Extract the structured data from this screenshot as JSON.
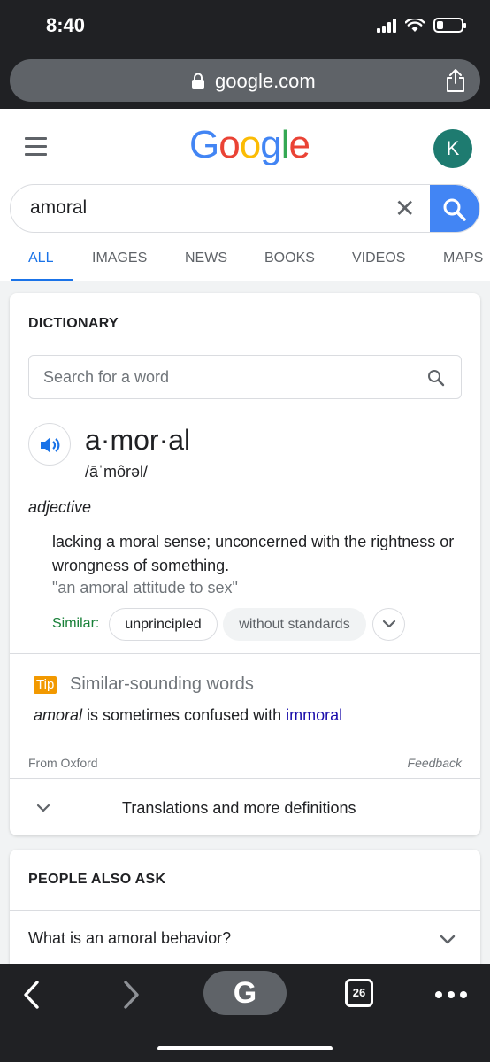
{
  "status_bar": {
    "time": "8:40"
  },
  "browser": {
    "url": "google.com"
  },
  "header": {
    "logo": [
      "G",
      "o",
      "o",
      "g",
      "l",
      "e"
    ],
    "logo_colors": [
      "#4285f4",
      "#ea4335",
      "#fbbc05",
      "#4285f4",
      "#34a853",
      "#ea4335"
    ],
    "avatar_initial": "K"
  },
  "search": {
    "query": "amoral",
    "clear": "✕"
  },
  "tabs": [
    "ALL",
    "IMAGES",
    "NEWS",
    "BOOKS",
    "VIDEOS",
    "MAPS"
  ],
  "dictionary": {
    "title": "DICTIONARY",
    "search_placeholder": "Search for a word",
    "headword": "a·mor·al",
    "phonetic": "/āˈmôrəl/",
    "part_of_speech": "adjective",
    "definition": "lacking a moral sense; unconcerned with the rightness or wrongness of something.",
    "example": "\"an amoral attitude to sex\"",
    "similar_label": "Similar:",
    "similar": [
      "unprincipled",
      "without standards"
    ],
    "tip_badge": "Tip",
    "tip_title": "Similar-sounding words",
    "tip_word": "amoral",
    "tip_middle": " is sometimes confused with ",
    "tip_link": "immoral",
    "source": "From Oxford",
    "feedback": "Feedback",
    "more_label": "Translations and more definitions"
  },
  "people_also_ask": {
    "title": "PEOPLE ALSO ASK",
    "questions": [
      "What is an amoral behavior?"
    ]
  },
  "toolbar": {
    "home_label": "G",
    "tab_count": "26"
  },
  "colors": {
    "accent_blue": "#1a73e8",
    "search_button": "#4285f4",
    "similar_green": "#188038",
    "tip_orange": "#f29900",
    "avatar": "#1e7b70"
  }
}
